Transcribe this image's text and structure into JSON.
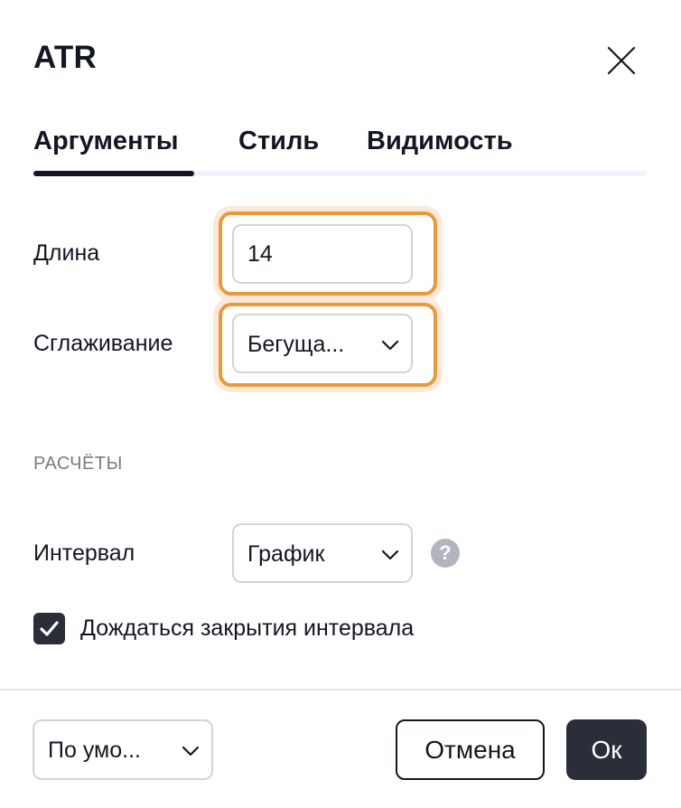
{
  "dialog": {
    "title": "ATR",
    "close_icon": "close-icon"
  },
  "tabs": [
    {
      "label": "Аргументы",
      "active": true
    },
    {
      "label": "Стиль",
      "active": false
    },
    {
      "label": "Видимость",
      "active": false
    }
  ],
  "inputs": {
    "length_label": "Длина",
    "length_value": "14",
    "smoothing_label": "Сглаживание",
    "smoothing_value": "Бегуща..."
  },
  "calculations": {
    "section_title": "РАСЧЁТЫ",
    "interval_label": "Интервал",
    "interval_value": "График",
    "help_glyph": "?",
    "wait_close_label": "Дождаться закрытия интервала",
    "wait_close_checked": true
  },
  "footer": {
    "defaults_value": "По умо...",
    "cancel_label": "Отмена",
    "ok_label": "Ок"
  },
  "colors": {
    "highlight": "#e8993a",
    "primary_dark": "#2a2e39",
    "text": "#131722",
    "muted": "#787b86"
  }
}
